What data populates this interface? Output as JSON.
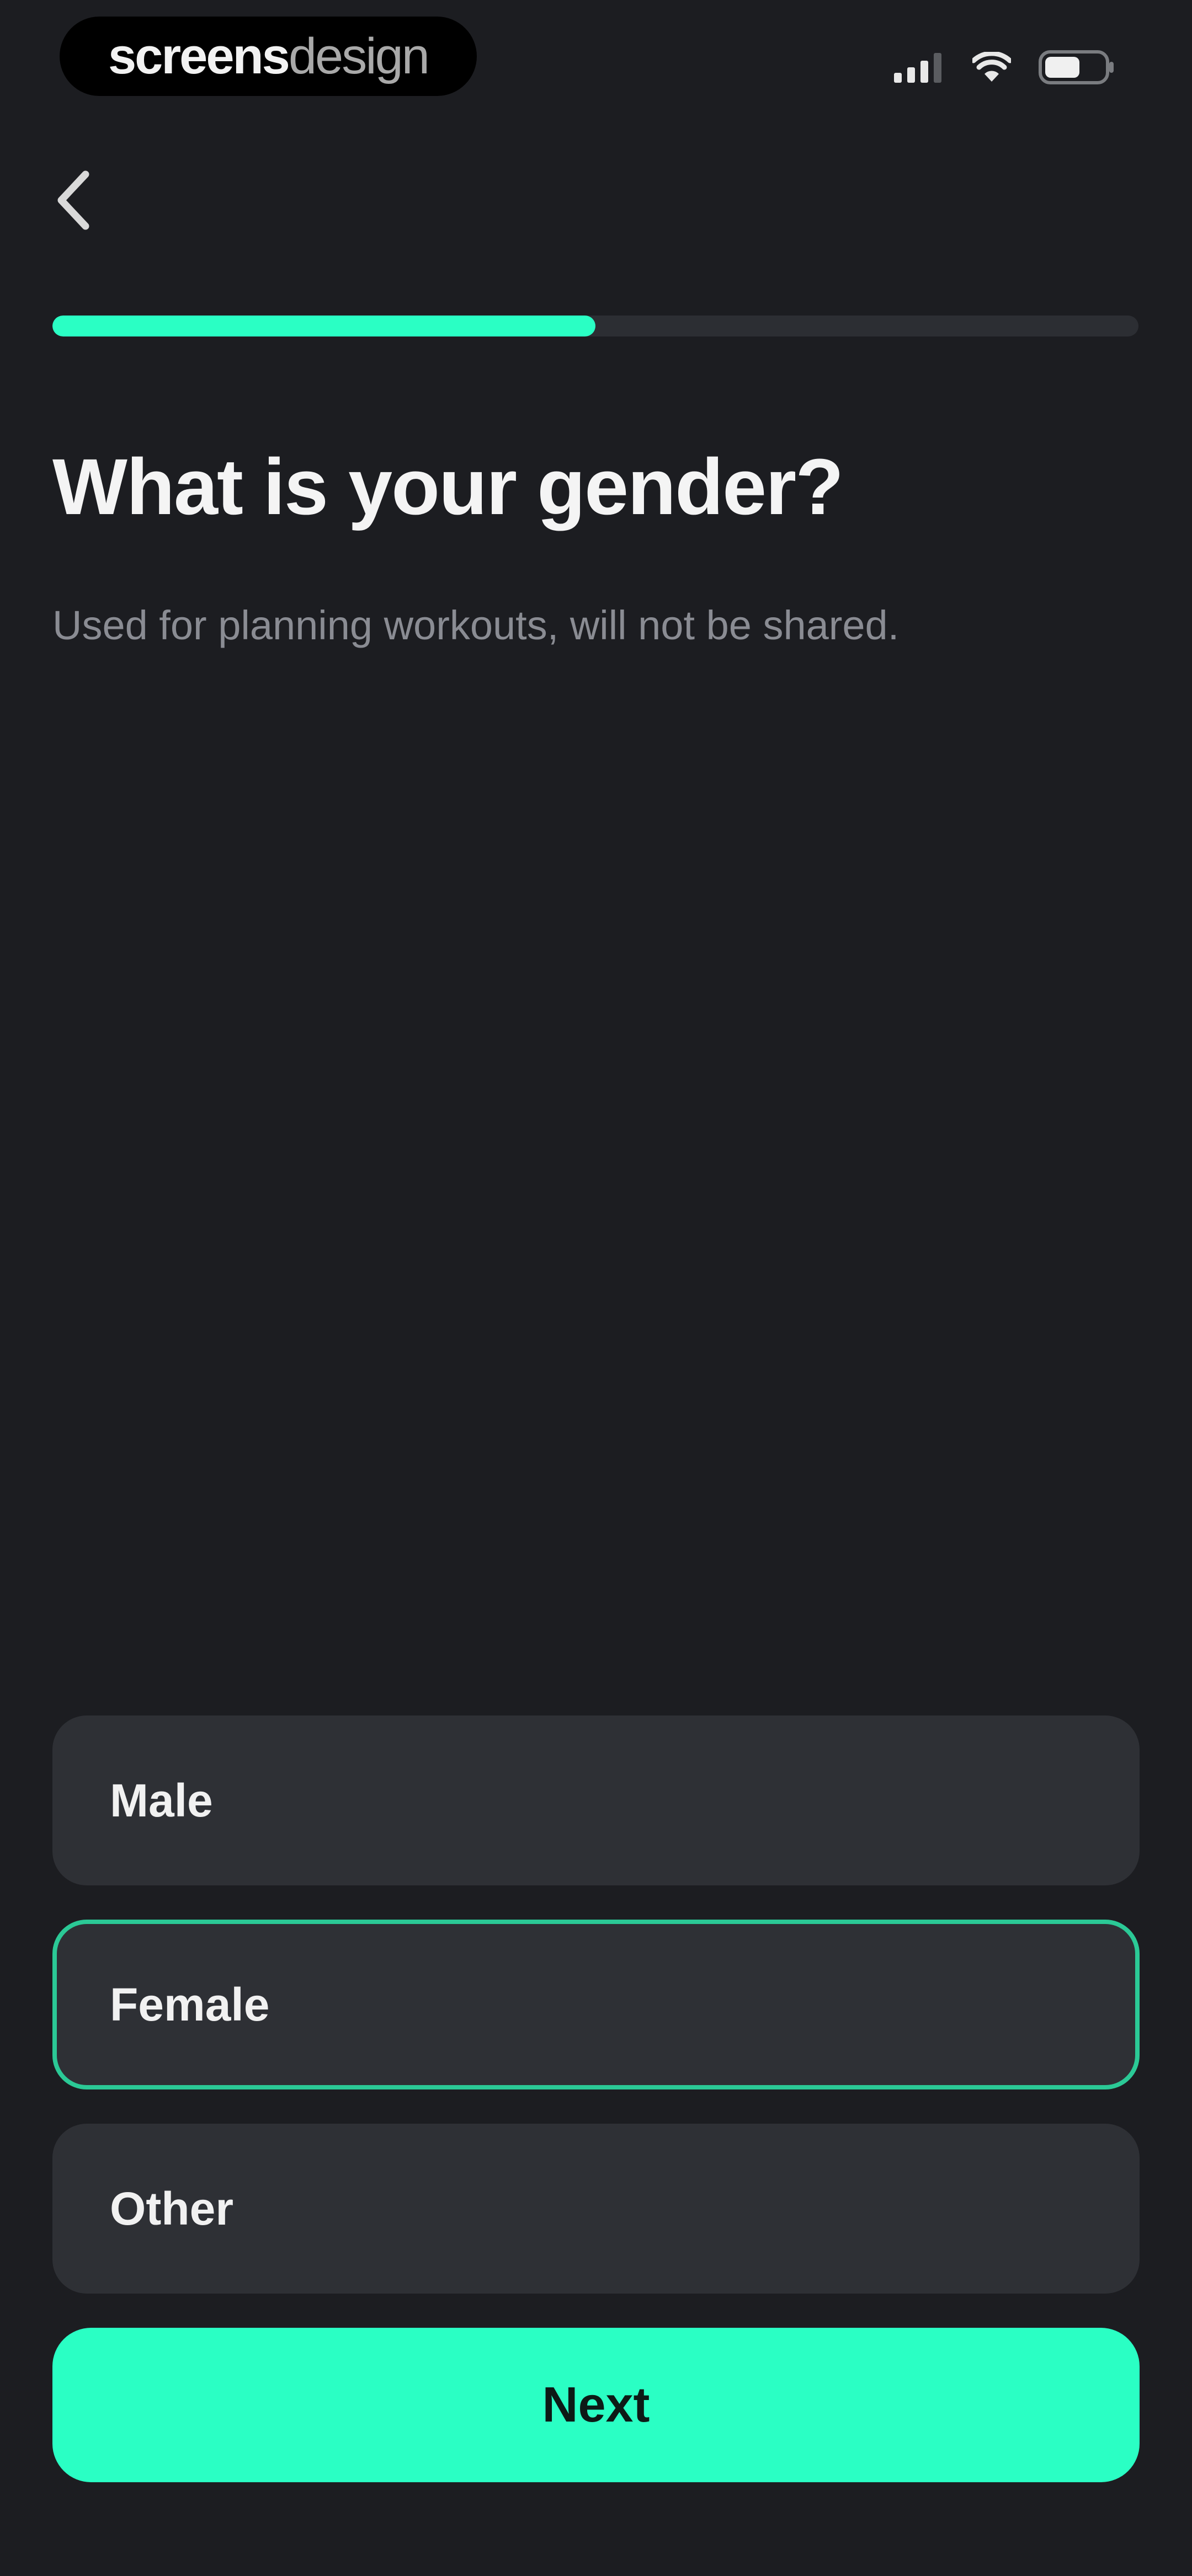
{
  "watermark": {
    "text_bold": "screens",
    "text_light": "design"
  },
  "status_bar": {
    "icons": [
      "cellular-signal-icon",
      "wifi-icon",
      "battery-icon"
    ]
  },
  "header": {
    "back_icon": "chevron-left-icon"
  },
  "progress": {
    "value": 0.5
  },
  "main": {
    "title": "What is your gender?",
    "subtitle": "Used for planning workouts, will not be shared."
  },
  "options": [
    {
      "label": "Male",
      "selected": false
    },
    {
      "label": "Female",
      "selected": true
    },
    {
      "label": "Other",
      "selected": false
    }
  ],
  "footer": {
    "next_label": "Next"
  },
  "colors": {
    "background": "#1c1d21",
    "accent": "#2affc4",
    "selected_border": "#2bc996",
    "option_bg": "#2e3035",
    "progress_track": "#2c2e33",
    "subtitle": "#8a8c93"
  }
}
